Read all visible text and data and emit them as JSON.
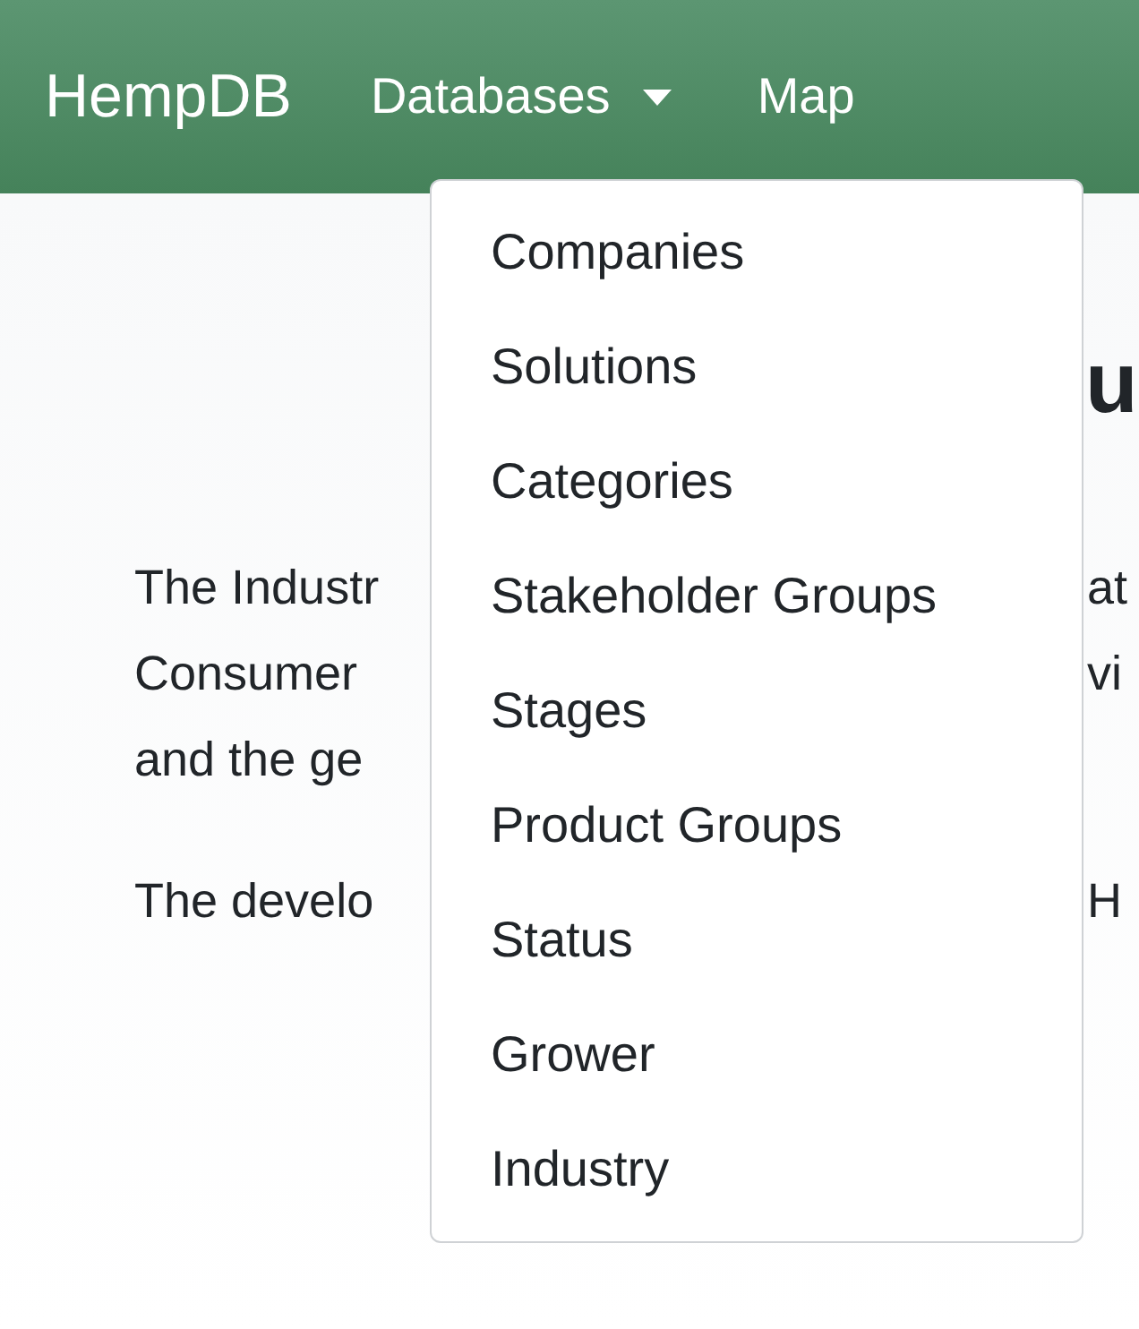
{
  "navbar": {
    "brand": "HempDB",
    "items": [
      {
        "label": "Databases",
        "kind": "dropdown",
        "expanded": true
      },
      {
        "label": "Map",
        "kind": "link"
      }
    ]
  },
  "dropdown": {
    "items": [
      "Companies",
      "Solutions",
      "Categories",
      "Stakeholder Groups",
      "Stages",
      "Product Groups",
      "Status",
      "Grower",
      "Industry"
    ]
  },
  "content": {
    "heading_fragment": "u",
    "paragraphs": [
      [
        {
          "left": "The Industr",
          "right": "at"
        },
        {
          "left": "Consumer",
          "right": "vi"
        },
        {
          "left": "and the ge"
        }
      ],
      [
        {
          "left": "The develo",
          "right": "H"
        }
      ]
    ]
  }
}
